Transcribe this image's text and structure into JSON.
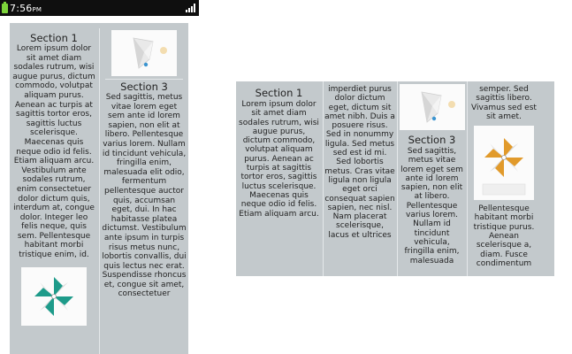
{
  "status_bar": {
    "time": "7:56",
    "ampm": "PM"
  },
  "sections": {
    "section1": {
      "title": "Section 1",
      "body": "Lorem ipsum dolor sit amet diam sodales rutrum, wisi augue purus, dictum commodo, volutpat aliquam purus. Aenean ac turpis at sagittis tortor eros, sagittis luctus scelerisque. Maecenas quis neque odio id felis. Etiam aliquam arcu. Vestibulum ante sodales rutrum, enim consectetuer dolor dictum quis, interdum at, congue dolor. Integer leo felis neque, quis sem. Pellentesque habitant morbi tristique enim, id."
    },
    "section3": {
      "title": "Section 3",
      "body": "Sed sagittis, metus vitae lorem eget sem ante id lorem sapien, non elit at libero. Pellentesque varius lorem. Nullam id tincidunt vehicula, fringilla enim, malesuada elit odio, fermentum pellentesque auctor quis, accumsan eget, dui. In hac habitasse platea dictumst. Vestibulum ante ipsum in turpis risus metus nunc, lobortis convallis, dui quis lectus nec erat. Suspendisse rhoncus et, congue sit amet, consectetuer"
    },
    "landscape_col1": {
      "title": "Section 1",
      "body": "Lorem ipsum dolor sit amet diam sodales rutrum, wisi augue purus, dictum commodo, volutpat aliquam purus. Aenean ac turpis at sagittis tortor eros, sagittis luctus scelerisque. Maecenas quis neque odio id felis. Etiam aliquam arcu."
    },
    "landscape_col2": {
      "body": "imperdiet purus dolor dictum eget, dictum sit amet nibh. Duis a posuere risus. Sed in nonummy ligula. Sed metus sed est id mi. Sed lobortis metus. Cras vitae ligula non ligula eget orci consequat sapien sapien, nec nisl. Nam placerat scelerisque, lacus et ultrices"
    },
    "landscape_col3": {
      "title": "Section 3",
      "body": "Sed sagittis, metus vitae lorem eget sem ante id lorem sapien, non elit at libero. Pellentesque varius lorem. Nullam id tincidunt vehicula, fringilla enim, malesuada"
    },
    "landscape_col4": {
      "body_top": "semper. Sed sagittis libero. Vivamus sed est sit amet.",
      "body_bottom": "Pellentesque habitant morbi tristique purus. Aenean scelerisque a, diam. Fusce condimentum"
    }
  },
  "colors": {
    "panel": "#c3c9cc",
    "statusbar": "#0f0f0f",
    "battery": "#7cd33a"
  },
  "icons": [
    "paper-note-icon",
    "teal-pinwheel-icon",
    "orange-pinwheel-icon",
    "signal-icon",
    "battery-icon"
  ]
}
